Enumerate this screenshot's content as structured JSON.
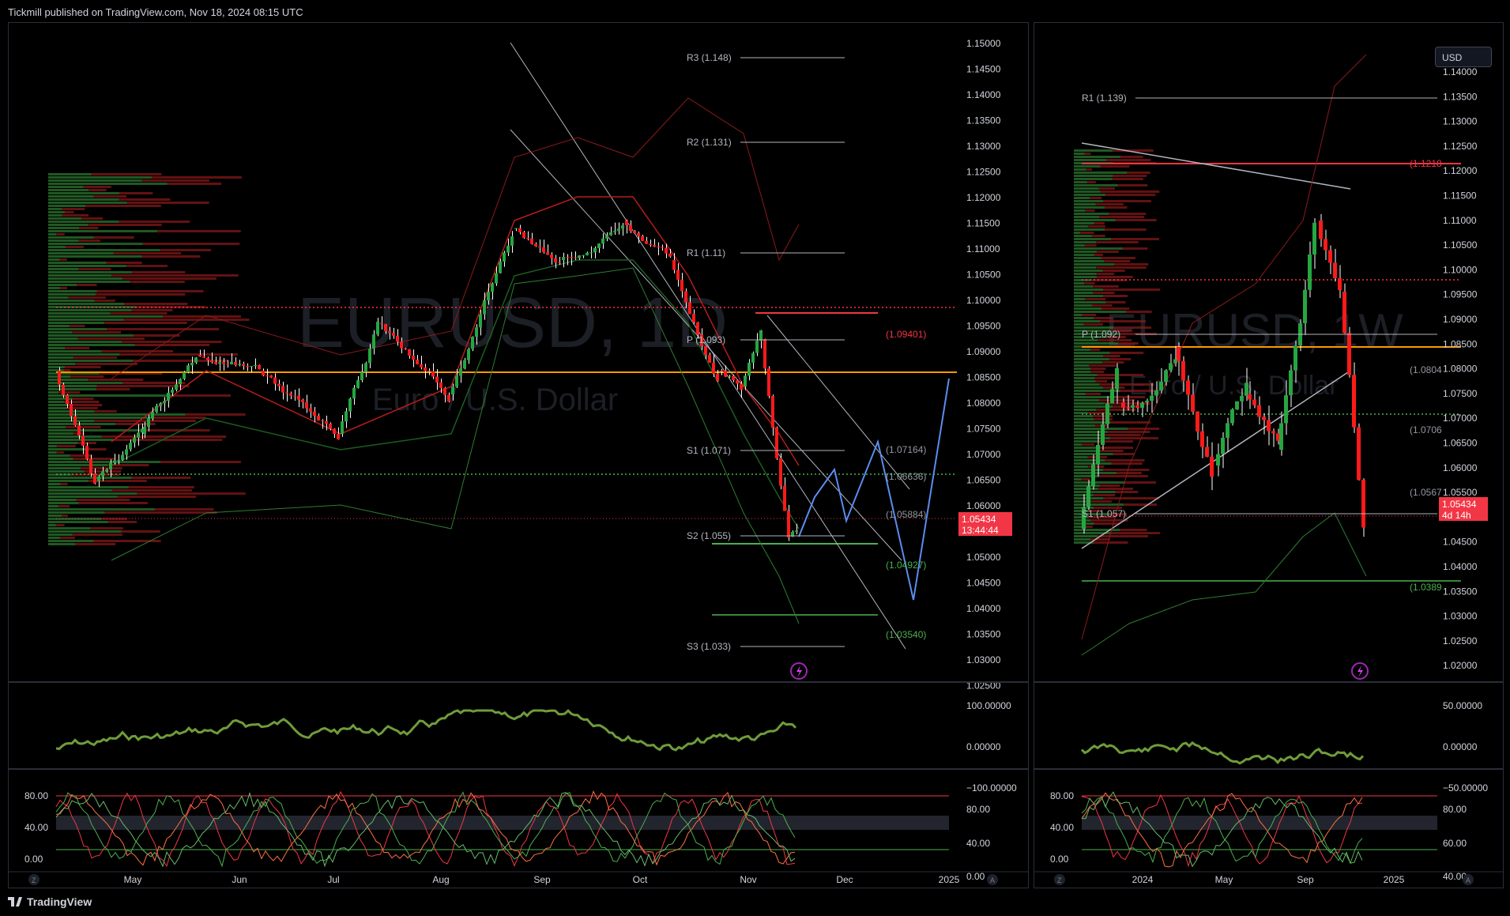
{
  "header": {
    "published": "Tickmill published on TradingView.com, Nov 18, 2024 08:15 UTC"
  },
  "footer": {
    "brand": "TradingView"
  },
  "colors": {
    "up": "#26a641",
    "down": "#ff1a1a",
    "pivot": "#ffffff",
    "orange": "#ff9800",
    "red_line": "#f23645",
    "green_line": "#4caf50"
  },
  "left_chart": {
    "watermark_symbol": "EURUSD, 1D",
    "watermark_name": "Euro / U.S. Dollar",
    "price_axis": [
      "1.15000",
      "1.14500",
      "1.14000",
      "1.13500",
      "1.13000",
      "1.12500",
      "1.12000",
      "1.11500",
      "1.11000",
      "1.10500",
      "1.10000",
      "1.09500",
      "1.09000",
      "1.08500",
      "1.08000",
      "1.07500",
      "1.07000",
      "1.06500",
      "1.06000",
      "1.05500",
      "1.05000",
      "1.04500",
      "1.04000",
      "1.03500",
      "1.03000",
      "1.02500"
    ],
    "pivots": [
      {
        "label": "R3 (1.148)"
      },
      {
        "label": "R2 (1.131)"
      },
      {
        "label": "R1 (1.11)"
      },
      {
        "label": "P (1.093)"
      },
      {
        "label": "S1 (1.071)"
      },
      {
        "label": "S2 (1.055)"
      },
      {
        "label": "S3 (1.033)"
      }
    ],
    "levels": [
      {
        "label": "(1.09401)",
        "color": "#f23645"
      },
      {
        "label": "(1.07164)",
        "color": "#9598a1"
      },
      {
        "label": "(1.06636)",
        "color": "#9598a1"
      },
      {
        "label": "(1.05884)",
        "color": "#9598a1"
      },
      {
        "label": "(1.04927)",
        "color": "#4caf50"
      },
      {
        "label": "(1.03540)",
        "color": "#4caf50"
      }
    ],
    "last_price": "1.05434",
    "countdown": "13:44:44",
    "time_axis": [
      "May",
      "Jun",
      "Jul",
      "Aug",
      "Sep",
      "Oct",
      "Nov",
      "Dec",
      "2025"
    ],
    "osc1_axis": [
      "100.00000",
      "0.00000",
      "−100.00000"
    ],
    "osc2_axis": [
      "80.00",
      "40.00",
      "0.00"
    ],
    "osc2_left": [
      "80.00",
      "40.00",
      "0.00"
    ]
  },
  "right_chart": {
    "currency_button": "USD",
    "watermark_symbol": "EURUSD, 1W",
    "watermark_name": "Euro / U.S. Dollar",
    "price_axis": [
      "1.14000",
      "1.13500",
      "1.13000",
      "1.12500",
      "1.12000",
      "1.11500",
      "1.11000",
      "1.10500",
      "1.10000",
      "1.09500",
      "1.09000",
      "1.08500",
      "1.08000",
      "1.07500",
      "1.07000",
      "1.06500",
      "1.06000",
      "1.05500",
      "1.05000",
      "1.04500",
      "1.04000",
      "1.03500",
      "1.03000",
      "1.02500",
      "1.02000"
    ],
    "pivots": [
      {
        "label": "R1 (1.139)"
      },
      {
        "label": "P (1.092)"
      },
      {
        "label": "S1 (1.057)"
      }
    ],
    "levels": [
      {
        "label": "(1.1218",
        "color": "#f23645"
      },
      {
        "label": "(1.0804",
        "color": "#9598a1"
      },
      {
        "label": "(1.0706",
        "color": "#9598a1"
      },
      {
        "label": "(1.0567",
        "color": "#9598a1"
      },
      {
        "label": "(1.0389",
        "color": "#4caf50"
      }
    ],
    "last_price": "1.05434",
    "countdown": "4d 14h",
    "time_axis": [
      "2024",
      "May",
      "Sep",
      "2025"
    ],
    "osc1_axis": [
      "50.00000",
      "0.00000",
      "−50.00000"
    ],
    "osc2_axis": [
      "80.00",
      "60.00",
      "40.00"
    ],
    "osc2_left": [
      "80.00",
      "40.00",
      "0.00"
    ]
  },
  "corner_buttons": {
    "z": "Z",
    "a": "A"
  }
}
